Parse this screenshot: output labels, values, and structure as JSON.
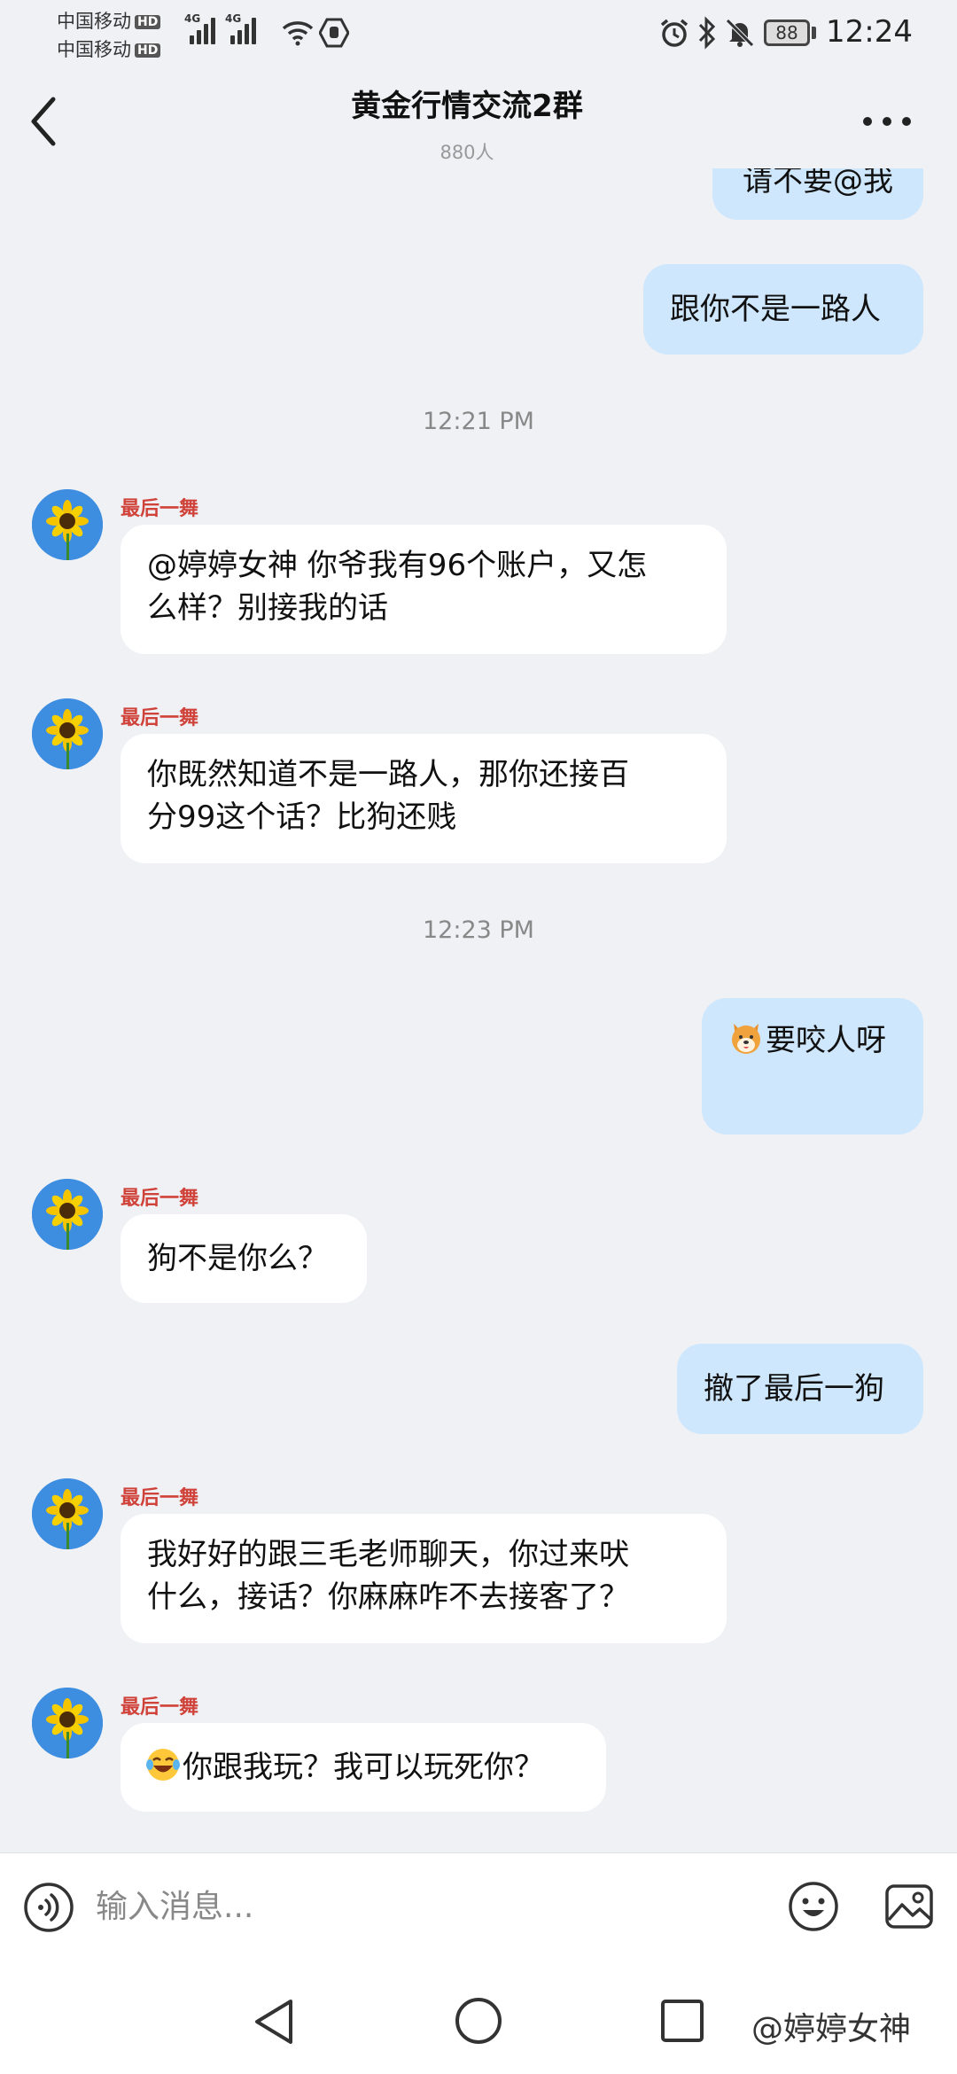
{
  "status": {
    "carrier1": "中国移动",
    "carrier2": "中国移动",
    "hd": "HD",
    "net1": "4G",
    "net2": "4G",
    "battery": "88",
    "time": "12:24",
    "icons": [
      "wifi-icon",
      "vpn-icon",
      "alarm-icon",
      "bluetooth-icon",
      "mute-icon"
    ]
  },
  "header": {
    "title": "黄金行情交流2群",
    "subtitle": "880人",
    "back_icon": "chevron-left-icon",
    "more_icon": "more-horizontal-icon"
  },
  "messages": {
    "m0": "请不要@我",
    "m1": "跟你不是一路人",
    "t1": "12:21 PM",
    "m2_sender": "最后一舞",
    "m2_line1": "@婷婷女神 你爷我有96个账户，又怎",
    "m2_line2": "么样？别接我的话",
    "m3_sender": "最后一舞",
    "m3_line1": "你既然知道不是一路人，那你还接百",
    "m3_line2": "分99这个话？比狗还贱",
    "t2": "12:23 PM",
    "m4": "要咬人呀",
    "m5_sender": "最后一舞",
    "m5": "狗不是你么？",
    "m6": "撤了最后一狗",
    "m7_sender": "最后一舞",
    "m7_line1": "我好好的跟三毛老师聊天，你过来吠",
    "m7_line2": "什么，接话？你麻麻咋不去接客了？",
    "m8_sender": "最后一舞",
    "m8": "你跟我玩？我可以玩死你？"
  },
  "input": {
    "placeholder": "输入消息...",
    "voice_icon": "voice-icon",
    "emoji_icon": "emoji-icon",
    "image_icon": "image-icon"
  },
  "nav": {
    "back_icon": "nav-back-icon",
    "home_icon": "nav-home-icon",
    "recent_icon": "nav-recent-icon",
    "watermark": "@婷婷女神"
  },
  "colors": {
    "background": "#eff1f5",
    "outgoing_bubble": "#cfe7fd",
    "incoming_bubble": "#ffffff",
    "sender_name": "#d0433a",
    "avatar_bg": "#3d8de0"
  }
}
